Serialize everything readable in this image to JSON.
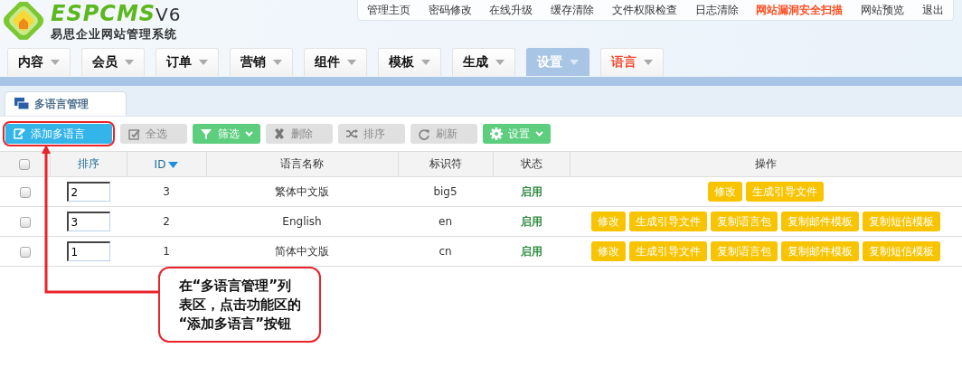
{
  "logo": {
    "name": "ESPCMS",
    "version": "V6",
    "subtitle": "易思企业网站管理系统"
  },
  "top_links": [
    {
      "label": "管理主页",
      "highlight": false
    },
    {
      "label": "密码修改",
      "highlight": false
    },
    {
      "label": "在线升级",
      "highlight": false
    },
    {
      "label": "缓存清除",
      "highlight": false
    },
    {
      "label": "文件权限检查",
      "highlight": false
    },
    {
      "label": "日志清除",
      "highlight": false
    },
    {
      "label": "网站漏洞安全扫描",
      "highlight": true
    },
    {
      "label": "网站预览",
      "highlight": false
    },
    {
      "label": "退出",
      "highlight": false
    }
  ],
  "nav_tabs": [
    {
      "label": "内容",
      "selected": false,
      "highlight": false
    },
    {
      "label": "会员",
      "selected": false,
      "highlight": false
    },
    {
      "label": "订单",
      "selected": false,
      "highlight": false
    },
    {
      "label": "营销",
      "selected": false,
      "highlight": false
    },
    {
      "label": "组件",
      "selected": false,
      "highlight": false
    },
    {
      "label": "模板",
      "selected": false,
      "highlight": false
    },
    {
      "label": "生成",
      "selected": false,
      "highlight": false
    },
    {
      "label": "设置",
      "selected": true,
      "highlight": false
    },
    {
      "label": "语言",
      "selected": false,
      "highlight": true
    }
  ],
  "page_tab": {
    "label": "多语言管理",
    "selected": true
  },
  "toolbar": [
    {
      "label": "添加多语言",
      "kind": "primary",
      "dropdown": false
    },
    {
      "label": "全选",
      "kind": "muted",
      "dropdown": false
    },
    {
      "label": "筛选",
      "kind": "success",
      "dropdown": true
    },
    {
      "label": "删除",
      "kind": "muted",
      "dropdown": false
    },
    {
      "label": "排序",
      "kind": "muted",
      "dropdown": false
    },
    {
      "label": "刷新",
      "kind": "muted",
      "dropdown": false
    },
    {
      "label": "设置",
      "kind": "success",
      "dropdown": true
    }
  ],
  "table": {
    "select_all": {
      "checked": false
    },
    "columns": [
      {
        "label": "排序",
        "sorted": false
      },
      {
        "label": "ID",
        "sorted": true
      },
      {
        "label": "语言名称",
        "sorted": false
      },
      {
        "label": "标识符",
        "sorted": false
      },
      {
        "label": "状态",
        "sorted": false
      },
      {
        "label": "操作",
        "sorted": false
      }
    ],
    "rows": [
      {
        "checked": false,
        "order": "2",
        "id": "3",
        "name": "繁体中文版",
        "code": "big5",
        "status": "启用",
        "actions": [
          "修改",
          "生成引导文件"
        ]
      },
      {
        "checked": false,
        "order": "3",
        "id": "2",
        "name": "English",
        "code": "en",
        "status": "启用",
        "actions": [
          "修改",
          "生成引导文件",
          "复制语言包",
          "复制邮件模板",
          "复制短信模板"
        ]
      },
      {
        "checked": false,
        "order": "1",
        "id": "1",
        "name": "简体中文版",
        "code": "cn",
        "status": "启用",
        "actions": [
          "修改",
          "生成引导文件",
          "复制语言包",
          "复制邮件模板",
          "复制短信模板"
        ]
      }
    ]
  },
  "callout": {
    "lines": [
      "在“多语言管理”列",
      "表区，点击功能区的",
      "“添加多语言”按钮"
    ]
  }
}
